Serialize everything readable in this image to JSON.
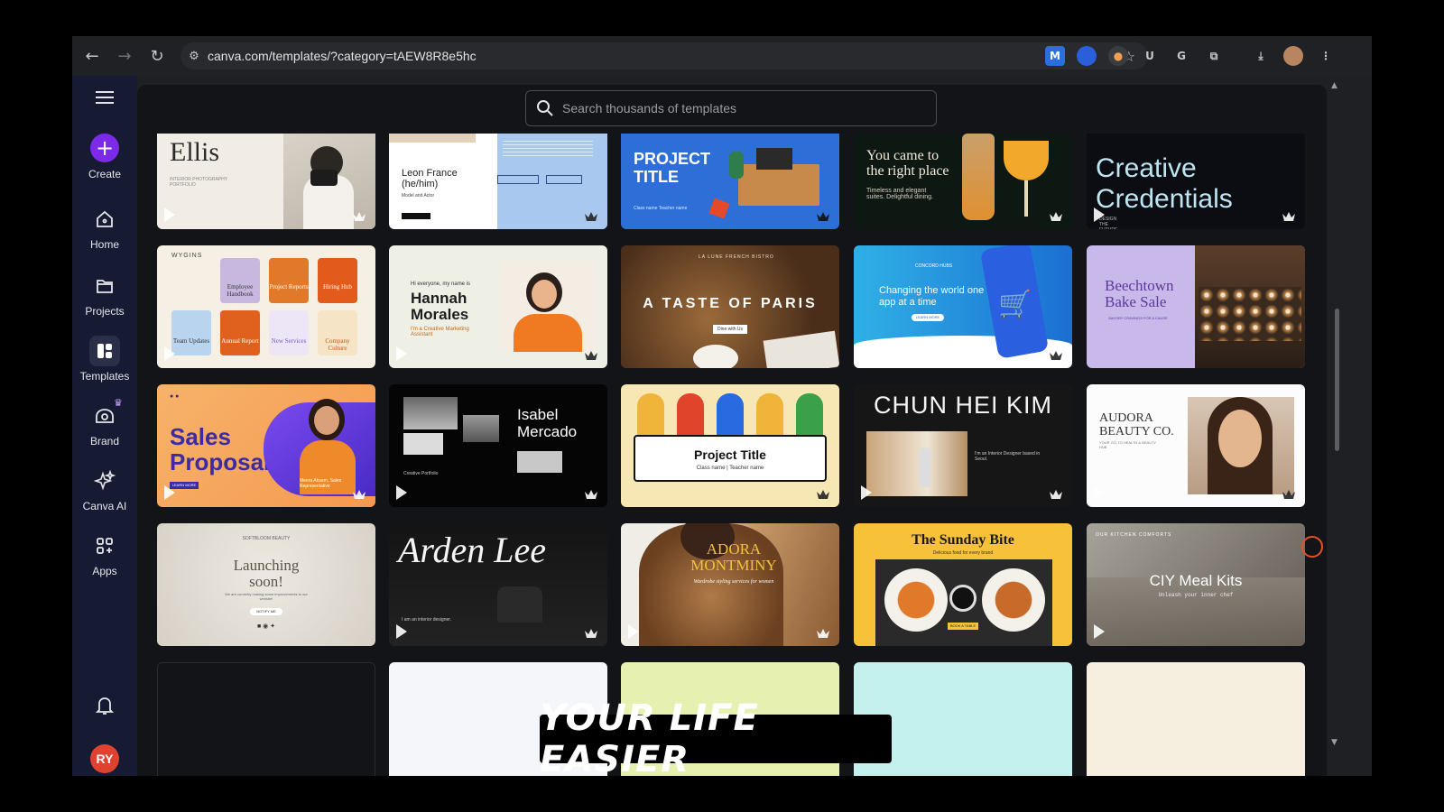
{
  "browser": {
    "url": "canva.com/templates/?category=tAEW8R8e5hc",
    "extensions": [
      "M",
      "A",
      "U",
      "G"
    ]
  },
  "sidebar": {
    "items": [
      {
        "label": "Create"
      },
      {
        "label": "Home"
      },
      {
        "label": "Projects"
      },
      {
        "label": "Templates"
      },
      {
        "label": "Brand"
      },
      {
        "label": "Canva AI"
      },
      {
        "label": "Apps"
      }
    ],
    "avatar": "RY"
  },
  "search": {
    "placeholder": "Search thousands of templates"
  },
  "templates": {
    "row1": [
      {
        "title": "Ellis",
        "sub": "INTERIOR PHOTOGRAPHY PORTFOLIO"
      },
      {
        "title": "Leon France (he/him)",
        "sub": "Model and Actor"
      },
      {
        "title": "PROJECT TITLE",
        "sub": "Class name Teacher name"
      },
      {
        "title": "You came to the right place",
        "sub": "Timeless and elegant suites. Delightful dining."
      },
      {
        "title": "Creative Credentials",
        "sub": "DESIGN THE FUTURE"
      }
    ],
    "row2": [
      {
        "title": "WYGINS",
        "tiles": [
          "Employee Handbook",
          "Project Reports",
          "Hiring Hub",
          "Team Updates",
          "Annual Report",
          "New Services",
          "Company Culture"
        ]
      },
      {
        "title": "Hannah Morales",
        "pre": "Hi everyone, my name is",
        "sub": "I'm a Creative Marketing Assistant"
      },
      {
        "title": "A TASTE OF PARIS",
        "pre": "LA LUNE FRENCH BISTRO",
        "sub": "Dine with Us"
      },
      {
        "title": "Changing the world one app at a time",
        "pre": "CONCORD HUBS",
        "sub": "LEARN MORE"
      },
      {
        "title": "Beechtown Bake Sale",
        "sub": "SAVORY CRAVINGS FOR A CAUSE"
      }
    ],
    "row3": [
      {
        "title": "Sales Proposal",
        "sub": "Meera Ahsem, Sales Representative",
        "btn": "LEARN MORE"
      },
      {
        "title": "Isabel Mercado",
        "sub": "Creative Portfolio"
      },
      {
        "title": "Project Title",
        "sub": "Class name | Teacher name"
      },
      {
        "title": "CHUN HEI KIM",
        "sub": "I'm an Interior Designer based in Seoul."
      },
      {
        "title": "AUDORA BEAUTY CO.",
        "sub": "YOUR GO-TO HEALTH & BEAUTY HUB"
      }
    ],
    "row4": [
      {
        "title": "Launching soon!",
        "pre": "SOFTBLOOM BEAUTY",
        "sub": "We are currently making some improvements to our website!",
        "btn": "NOTIFY ME"
      },
      {
        "title": "Arden Lee",
        "sub": "I am an interior designer."
      },
      {
        "title": "ADORA MONTMINY",
        "sub": "Wardrobe styling services for women"
      },
      {
        "title": "The Sunday Bite",
        "sub": "Delicious food for every brand",
        "btn": "BOOK A TABLE"
      },
      {
        "title": "CIY Meal Kits",
        "pre": "OUR KITCHEN COMFORTS",
        "sub": "Unleash your inner chef"
      }
    ]
  },
  "help": "?",
  "caption": "YOUR LIFE EASIER"
}
